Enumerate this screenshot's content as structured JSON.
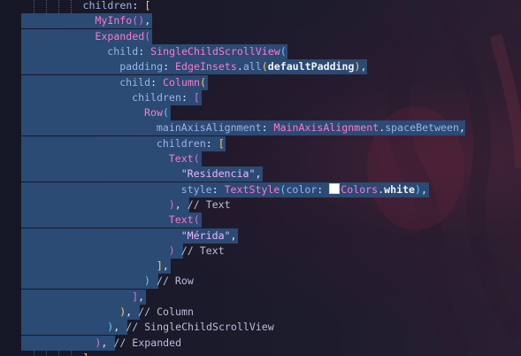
{
  "editor": {
    "colors": {
      "background": "#1a1b2a",
      "selection": "#2b4a74",
      "property": "#9bb3e6",
      "class": "#ff79c6",
      "string": "#ecb9f7",
      "comment": "#b9bfd8",
      "bracket_gold": "#ffd05a",
      "bracket_orchid": "#da70d6",
      "bracket_cyan": "#5fd3f3"
    },
    "gutter_icon": "lightbulb-icon",
    "color_swatch": "#ffffff",
    "lines": [
      {
        "indent": 10,
        "tokens": [
          {
            "t": "children",
            "c": "prop"
          },
          {
            "t": ": ",
            "c": "punc"
          },
          {
            "t": "[",
            "c": "br1"
          }
        ]
      },
      {
        "indent": 12,
        "tokens": [
          {
            "t": "MyInfo",
            "c": "cls"
          },
          {
            "t": "()",
            "c": "br2"
          },
          {
            "t": ",",
            "c": "punc"
          }
        ]
      },
      {
        "indent": 12,
        "tokens": [
          {
            "t": "Expanded",
            "c": "cls"
          },
          {
            "t": "(",
            "c": "br2"
          }
        ]
      },
      {
        "indent": 14,
        "tokens": [
          {
            "t": "child",
            "c": "prop"
          },
          {
            "t": ": ",
            "c": "punc"
          },
          {
            "t": "SingleChildScrollView",
            "c": "cls"
          },
          {
            "t": "(",
            "c": "br3"
          }
        ]
      },
      {
        "indent": 16,
        "tokens": [
          {
            "t": "padding",
            "c": "prop"
          },
          {
            "t": ": ",
            "c": "punc"
          },
          {
            "t": "EdgeInsets",
            "c": "cls"
          },
          {
            "t": ".",
            "c": "punc"
          },
          {
            "t": "all",
            "c": "prop"
          },
          {
            "t": "(",
            "c": "br1"
          },
          {
            "t": "defaultPadding",
            "c": "bold"
          },
          {
            "t": ")",
            "c": "br1"
          },
          {
            "t": ",",
            "c": "punc"
          }
        ]
      },
      {
        "indent": 16,
        "tokens": [
          {
            "t": "child",
            "c": "prop"
          },
          {
            "t": ": ",
            "c": "punc"
          },
          {
            "t": "Column",
            "c": "cls"
          },
          {
            "t": "(",
            "c": "br1"
          }
        ]
      },
      {
        "indent": 18,
        "tokens": [
          {
            "t": "children",
            "c": "prop"
          },
          {
            "t": ": ",
            "c": "punc"
          },
          {
            "t": "[",
            "c": "br2"
          }
        ]
      },
      {
        "indent": 20,
        "tokens": [
          {
            "t": "Row",
            "c": "cls"
          },
          {
            "t": "(",
            "c": "br3"
          }
        ]
      },
      {
        "indent": 22,
        "tokens": [
          {
            "t": "mainAxisAlignment",
            "c": "prop"
          },
          {
            "t": ": ",
            "c": "punc"
          },
          {
            "t": "MainAxisAlignment",
            "c": "cls"
          },
          {
            "t": ".",
            "c": "punc"
          },
          {
            "t": "spaceBetween",
            "c": "prop"
          },
          {
            "t": ",",
            "c": "punc"
          }
        ]
      },
      {
        "indent": 22,
        "tokens": [
          {
            "t": "children",
            "c": "prop"
          },
          {
            "t": ": ",
            "c": "punc"
          },
          {
            "t": "[",
            "c": "br1"
          }
        ]
      },
      {
        "indent": 24,
        "tokens": [
          {
            "t": "Text",
            "c": "cls"
          },
          {
            "t": "(",
            "c": "br2"
          }
        ]
      },
      {
        "indent": 26,
        "tokens": [
          {
            "t": "\"Residencia\"",
            "c": "str"
          },
          {
            "t": ",",
            "c": "punc"
          }
        ]
      },
      {
        "indent": 26,
        "tokens": [
          {
            "t": "style",
            "c": "prop"
          },
          {
            "t": ": ",
            "c": "punc"
          },
          {
            "t": "TextStyle",
            "c": "cls"
          },
          {
            "t": "(",
            "c": "br3"
          },
          {
            "t": "color",
            "c": "prop"
          },
          {
            "t": ": ",
            "c": "punc"
          },
          {
            "t": "",
            "c": "swatch"
          },
          {
            "t": "Colors",
            "c": "cls"
          },
          {
            "t": ".",
            "c": "punc"
          },
          {
            "t": "white",
            "c": "bold"
          },
          {
            "t": ")",
            "c": "br3"
          },
          {
            "t": ",",
            "c": "punc"
          }
        ]
      },
      {
        "indent": 24,
        "tokens": [
          {
            "t": ")",
            "c": "br2"
          },
          {
            "t": ", ",
            "c": "punc"
          },
          {
            "t": "// Text",
            "c": "com"
          }
        ]
      },
      {
        "indent": 24,
        "tokens": [
          {
            "t": "Text",
            "c": "cls"
          },
          {
            "t": "(",
            "c": "br2"
          }
        ]
      },
      {
        "indent": 26,
        "tokens": [
          {
            "t": "\"Mérida\"",
            "c": "str"
          },
          {
            "t": ",",
            "c": "punc"
          }
        ]
      },
      {
        "indent": 24,
        "tokens": [
          {
            "t": ")",
            "c": "br2"
          },
          {
            "t": " ",
            "c": "punc"
          },
          {
            "t": "// Text",
            "c": "com"
          }
        ]
      },
      {
        "indent": 22,
        "tokens": [
          {
            "t": "]",
            "c": "br1"
          },
          {
            "t": ",",
            "c": "punc"
          }
        ]
      },
      {
        "indent": 20,
        "tokens": [
          {
            "t": ")",
            "c": "br3"
          },
          {
            "t": " ",
            "c": "punc"
          },
          {
            "t": "// Row",
            "c": "com"
          }
        ]
      },
      {
        "indent": 18,
        "tokens": [
          {
            "t": "]",
            "c": "br2"
          },
          {
            "t": ",",
            "c": "punc"
          }
        ]
      },
      {
        "indent": 16,
        "tokens": [
          {
            "t": ")",
            "c": "br1"
          },
          {
            "t": ", ",
            "c": "punc"
          },
          {
            "t": "// Column",
            "c": "com"
          }
        ]
      },
      {
        "indent": 14,
        "tokens": [
          {
            "t": ")",
            "c": "br3"
          },
          {
            "t": ", ",
            "c": "punc"
          },
          {
            "t": "// SingleChildScrollView",
            "c": "com"
          }
        ]
      },
      {
        "indent": 12,
        "tokens": [
          {
            "t": ")",
            "c": "br2"
          },
          {
            "t": ", ",
            "c": "punc"
          },
          {
            "t": "// Expanded",
            "c": "com"
          }
        ]
      },
      {
        "indent": 10,
        "tokens": [
          {
            "t": "]",
            "c": "br1"
          }
        ]
      }
    ]
  }
}
